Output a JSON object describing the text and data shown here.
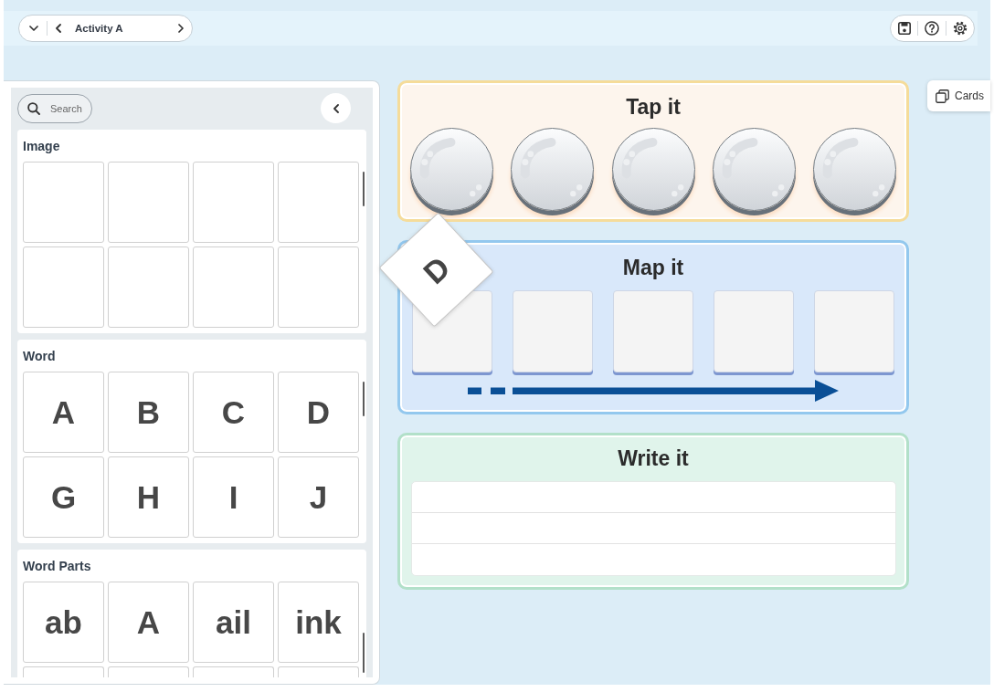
{
  "top_bar": {
    "activity_title": "Activity A"
  },
  "library": {
    "search": {
      "placeholder": "Search"
    },
    "sections": [
      {
        "title": "Image",
        "kind": "image",
        "more_below": false
      },
      {
        "title": "Word",
        "kind": "text",
        "tiles": [
          "A",
          "B",
          "C",
          "D",
          "G",
          "H",
          "I",
          "J"
        ],
        "more_below": false
      },
      {
        "title": "Word Parts",
        "kind": "text",
        "tiles": [
          "ab",
          "A",
          "ail",
          "ink"
        ],
        "more_below": true
      }
    ]
  },
  "dragged_card": {
    "text": "D"
  },
  "activities": [
    {
      "kind": "tap",
      "title": "Tap it"
    },
    {
      "kind": "map",
      "title": "Map it"
    },
    {
      "kind": "write",
      "title": "Write it"
    }
  ],
  "side_tab": {
    "label": "Cards"
  }
}
